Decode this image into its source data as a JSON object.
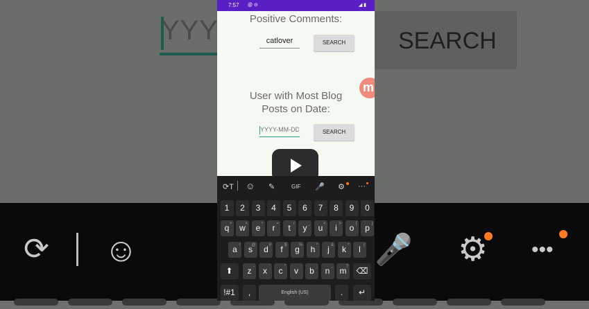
{
  "status_bar": {
    "time": "7:57",
    "icons_left": "@ ⊝",
    "icons_right": "◢ ▮"
  },
  "background": {
    "yyyy_text": "YYYY",
    "search_label": "SEARCH"
  },
  "section1": {
    "heading": "Positive Comments:",
    "field_value": "catlover",
    "button_label": "SEARCH"
  },
  "section2": {
    "heading_line1": "User with Most Blog",
    "heading_line2": "Posts on Date:",
    "field_placeholder": "YYYY-MM-DD",
    "button_label": "SEARCH"
  },
  "badge": {
    "letter": "m"
  },
  "keyboard": {
    "toolbar": [
      "⟳T",
      "☺",
      "✎",
      "GIF",
      "🎤",
      "⚙",
      "···"
    ],
    "numbers": [
      "1",
      "2",
      "3",
      "4",
      "5",
      "6",
      "7",
      "8",
      "9",
      "0"
    ],
    "row_q": [
      "q",
      "w",
      "e",
      "r",
      "t",
      "y",
      "u",
      "i",
      "o",
      "p"
    ],
    "row_q_hints": [
      "+",
      "×",
      "÷",
      "=",
      "/",
      "_",
      "<",
      ">",
      "[",
      "]"
    ],
    "row_a": [
      "a",
      "s",
      "d",
      "f",
      "g",
      "h",
      "j",
      "k",
      "l"
    ],
    "row_a_hints": [
      "!",
      "@",
      "#",
      "$",
      "%",
      "^",
      "&",
      "*",
      "("
    ],
    "row_z": [
      "z",
      "x",
      "c",
      "v",
      "b",
      "n",
      "m"
    ],
    "row_z_hints": [
      "-",
      "'",
      "\"",
      ":",
      ";",
      ",",
      "?"
    ],
    "shift": "⬆",
    "backspace": "⌫",
    "symbols": "!#1",
    "comma": ",",
    "space_label": "English (US)",
    "period": ".",
    "enter": "↵"
  },
  "accent_colors": {
    "status_bar": "#5a1fc4",
    "field_underline": "#2e9a87",
    "badge": "#f08a7c"
  }
}
